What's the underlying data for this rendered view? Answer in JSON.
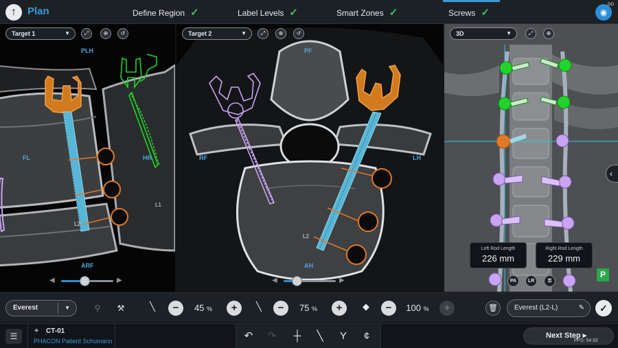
{
  "header": {
    "title": "Plan",
    "steps": [
      {
        "label": "Define Region",
        "done": true
      },
      {
        "label": "Label Levels",
        "done": true
      },
      {
        "label": "Smart Zones",
        "done": true
      },
      {
        "label": "Screws",
        "done": true
      }
    ],
    "camera_sup": "DO"
  },
  "views": [
    {
      "target": "Target 1",
      "orientation": {
        "top": "PLH",
        "left": "FL",
        "right": "HR",
        "bottom": "ARF"
      },
      "levels": [
        "L1",
        "L2"
      ],
      "slider_level": 0.45
    },
    {
      "target": "Target 2",
      "orientation": {
        "top": "PF",
        "left": "RF",
        "right": "LH",
        "bottom": "AH"
      },
      "levels": [
        "L2"
      ],
      "slider_level": 0.25
    },
    {
      "target": "3D",
      "left_rod": {
        "label": "Left Rod Length",
        "value": "226 mm"
      },
      "right_rod": {
        "label": "Right Rod Length",
        "value": "229 mm"
      },
      "view_buttons": [
        "PA",
        "LR"
      ],
      "badge": "P"
    }
  ],
  "toolbar": {
    "implant": "Everest",
    "screw_sizes": [
      {
        "value": "45",
        "unit": "%"
      },
      {
        "value": "75",
        "unit": "%"
      },
      {
        "value": "100",
        "unit": "%"
      }
    ],
    "selected_screw": "Everest (L2-L)"
  },
  "footer": {
    "case_id": "CT-01",
    "patient": "PHACON Patient Schumann",
    "next_label": "Next Step ▸",
    "fps": "FPS: 54.92"
  },
  "colors": {
    "accent": "#3a9ad9",
    "done_check": "#39c85b",
    "screw_orange": "#e07a28",
    "screw_green": "#22d42a",
    "screw_purple": "#c9a4f2",
    "screw_blue": "#5ab4d6"
  }
}
